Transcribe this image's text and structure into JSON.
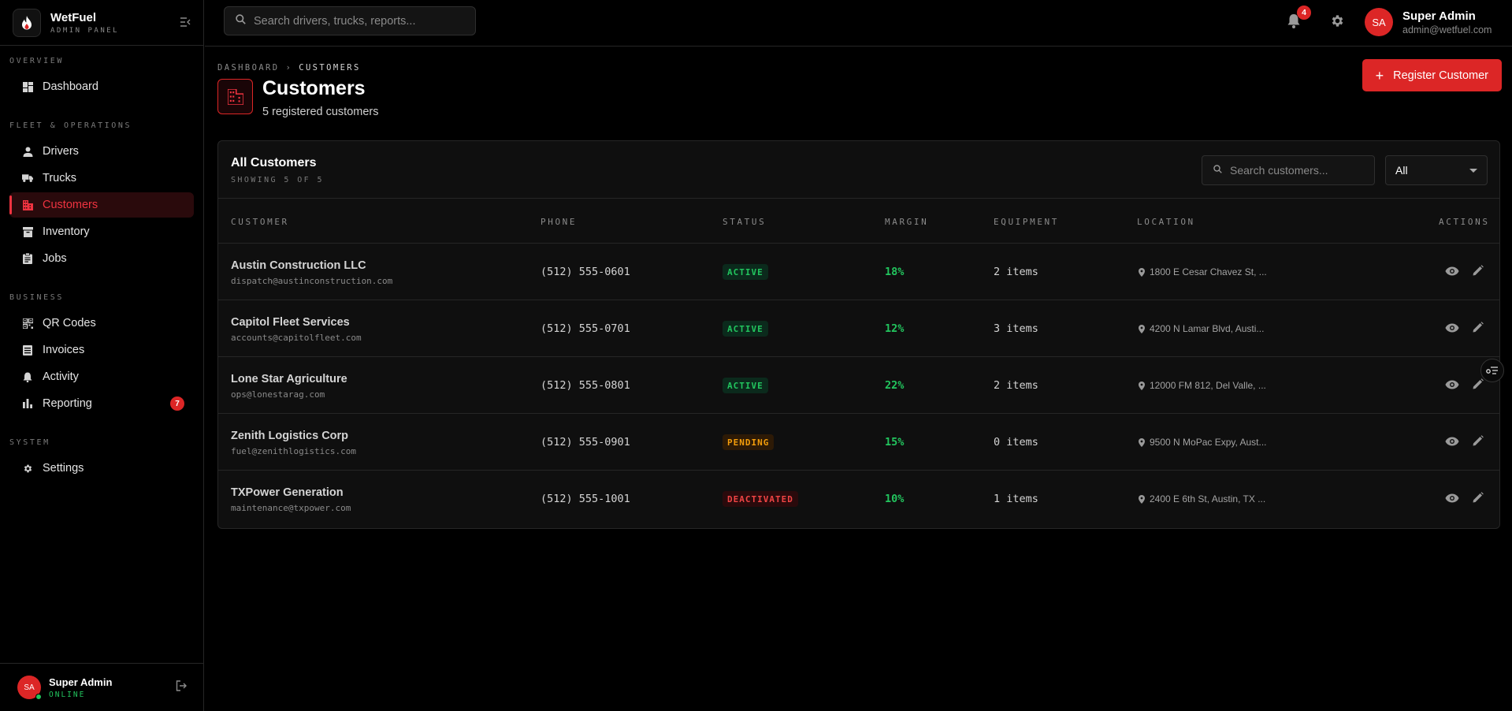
{
  "app": {
    "name": "WetFuel",
    "subtitle": "ADMIN PANEL",
    "brand_color": "#dc2626"
  },
  "sidebar": {
    "sections": [
      {
        "title": "OVERVIEW"
      },
      {
        "title": "FLEET & OPERATIONS"
      },
      {
        "title": "BUSINESS"
      },
      {
        "title": "SYSTEM"
      }
    ],
    "items": [
      {
        "label": "Dashboard",
        "icon": "dashboard-icon"
      },
      {
        "label": "Drivers",
        "icon": "person-icon"
      },
      {
        "label": "Trucks",
        "icon": "truck-icon"
      },
      {
        "label": "Customers",
        "icon": "building-icon",
        "active": true
      },
      {
        "label": "Inventory",
        "icon": "archive-icon"
      },
      {
        "label": "Jobs",
        "icon": "clipboard-icon"
      },
      {
        "label": "QR Codes",
        "icon": "qr-code-icon"
      },
      {
        "label": "Invoices",
        "icon": "receipt-icon"
      },
      {
        "label": "Activity",
        "icon": "bell-icon"
      },
      {
        "label": "Reporting",
        "icon": "bar-chart-icon",
        "badge": "7"
      },
      {
        "label": "Settings",
        "icon": "gear-icon"
      }
    ],
    "footer": {
      "initials": "SA",
      "name": "Super Admin",
      "status": "ONLINE"
    }
  },
  "topbar": {
    "search_placeholder": "Search drivers, trucks, reports...",
    "notification_count": "4",
    "user": {
      "initials": "SA",
      "name": "Super Admin",
      "email": "admin@wetfuel.com"
    }
  },
  "breadcrumb": {
    "root": "DASHBOARD",
    "separator": "›",
    "current": "CUSTOMERS"
  },
  "page": {
    "title": "Customers",
    "subtitle": "5 registered customers",
    "primary_action": "Register Customer"
  },
  "table": {
    "title": "All Customers",
    "count_text": "SHOWING 5 OF 5",
    "search_placeholder": "Search customers...",
    "filter_value": "All",
    "columns": [
      "CUSTOMER",
      "PHONE",
      "STATUS",
      "MARGIN",
      "EQUIPMENT",
      "LOCATION",
      "ACTIONS"
    ],
    "rows": [
      {
        "name": "Austin Construction LLC",
        "email": "dispatch@austinconstruction.com",
        "phone": "(512) 555-0601",
        "status": "ACTIVE",
        "status_kind": "active",
        "margin": "18%",
        "equipment": "2 items",
        "location": "1800 E Cesar Chavez St, ..."
      },
      {
        "name": "Capitol Fleet Services",
        "email": "accounts@capitolfleet.com",
        "phone": "(512) 555-0701",
        "status": "ACTIVE",
        "status_kind": "active",
        "margin": "12%",
        "equipment": "3 items",
        "location": "4200 N Lamar Blvd, Austi..."
      },
      {
        "name": "Lone Star Agriculture",
        "email": "ops@lonestarag.com",
        "phone": "(512) 555-0801",
        "status": "ACTIVE",
        "status_kind": "active",
        "margin": "22%",
        "equipment": "2 items",
        "location": "12000 FM 812, Del Valle, ..."
      },
      {
        "name": "Zenith Logistics Corp",
        "email": "fuel@zenithlogistics.com",
        "phone": "(512) 555-0901",
        "status": "PENDING",
        "status_kind": "pending",
        "margin": "15%",
        "equipment": "0 items",
        "location": "9500 N MoPac Expy, Aust..."
      },
      {
        "name": "TXPower Generation",
        "email": "maintenance@txpower.com",
        "phone": "(512) 555-1001",
        "status": "DEACTIVATED",
        "status_kind": "deactivated",
        "margin": "10%",
        "equipment": "1 items",
        "location": "2400 E 6th St, Austin, TX ..."
      }
    ]
  },
  "colors": {
    "accent": "#dc2626",
    "active": "#22c55e",
    "pending": "#f59e0b",
    "deactivated": "#ef4444"
  }
}
